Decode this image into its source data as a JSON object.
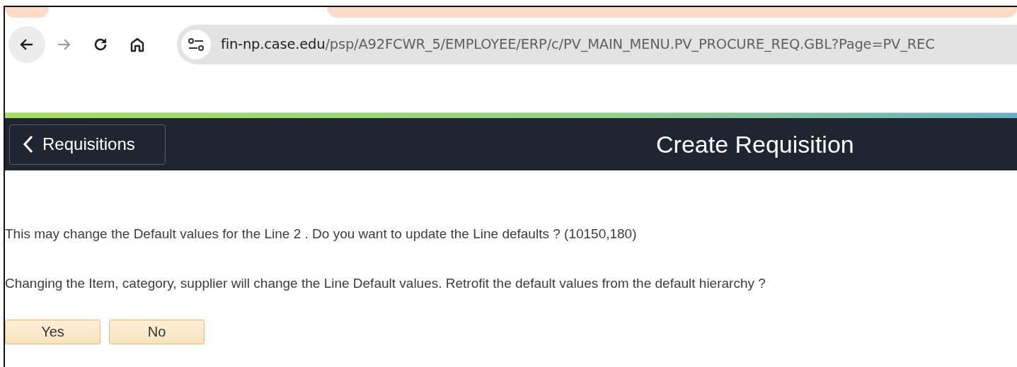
{
  "browser": {
    "address_bar": {
      "host": "fin-np.case.edu",
      "path": "/psp/A92FCWR_5/EMPLOYEE/ERP/c/PV_MAIN_MENU.PV_PROCURE_REQ.GBL?Page=PV_REC"
    },
    "forward_disabled": true
  },
  "header": {
    "back_button": "Requisitions",
    "title": "Create Requisition"
  },
  "messages": [
    "This may change the Default values for the Line 2 . Do you want to update the Line defaults ? (10150,180)",
    "Changing the Item, category, supplier will change the Line Default values. Retrofit the default values from the default hierarchy ?"
  ],
  "buttons": [
    "Yes",
    "No"
  ]
}
